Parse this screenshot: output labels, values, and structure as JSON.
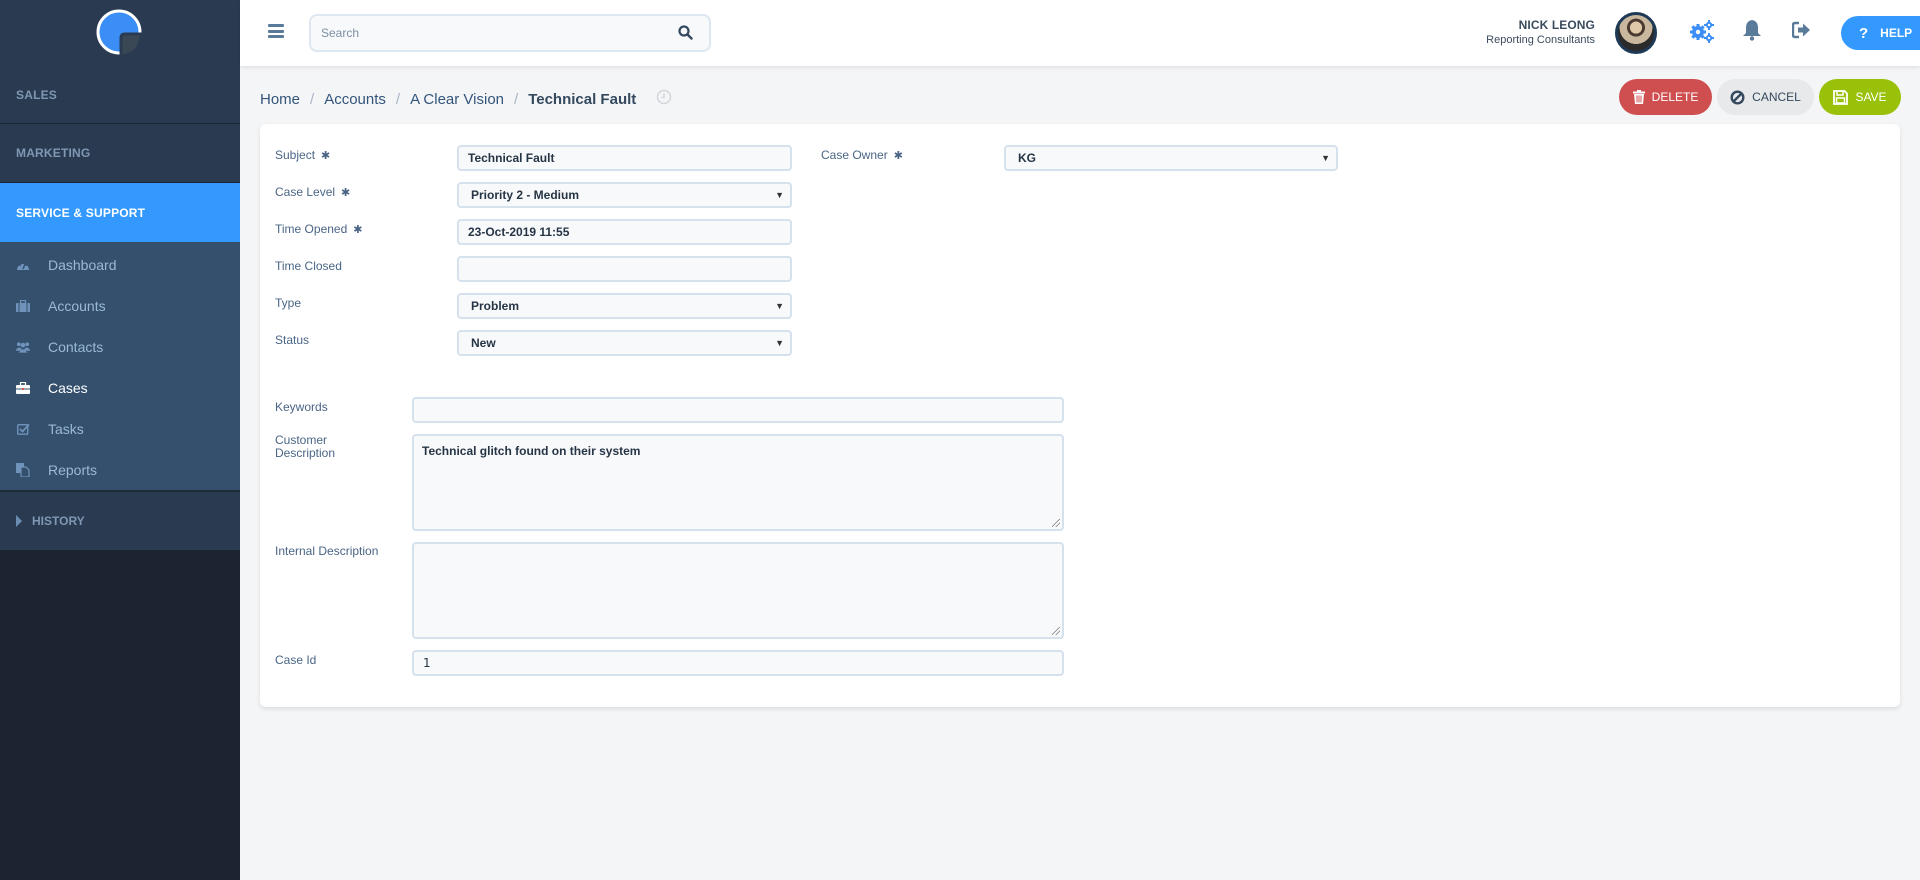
{
  "sidebar": {
    "sections": [
      {
        "label": "SALES"
      },
      {
        "label": "MARKETING"
      },
      {
        "label": "SERVICE & SUPPORT",
        "active": true
      }
    ],
    "items": [
      {
        "label": "Dashboard",
        "icon": "dashboard-icon"
      },
      {
        "label": "Accounts",
        "icon": "briefcase-icon"
      },
      {
        "label": "Contacts",
        "icon": "users-icon"
      },
      {
        "label": "Cases",
        "icon": "toolbox-icon",
        "active": true
      },
      {
        "label": "Tasks",
        "icon": "checkbox-icon"
      },
      {
        "label": "Reports",
        "icon": "copy-icon"
      }
    ],
    "history_label": "HISTORY"
  },
  "header": {
    "search_placeholder": "Search",
    "user_name": "NICK LEONG",
    "user_org": "Reporting Consultants",
    "help_label": "HELP"
  },
  "breadcrumb": {
    "items": [
      "Home",
      "Accounts",
      "A Clear Vision"
    ],
    "current": "Technical Fault"
  },
  "actions": {
    "delete_label": "DELETE",
    "cancel_label": "CANCEL",
    "save_label": "SAVE"
  },
  "form": {
    "subject": {
      "label": "Subject",
      "value": "Technical Fault",
      "required": true
    },
    "case_level": {
      "label": "Case Level",
      "value": "Priority 2 - Medium",
      "required": true
    },
    "time_opened": {
      "label": "Time Opened",
      "value": "23-Oct-2019 11:55",
      "required": true
    },
    "time_closed": {
      "label": "Time Closed",
      "value": ""
    },
    "type": {
      "label": "Type",
      "value": "Problem"
    },
    "status": {
      "label": "Status",
      "value": "New"
    },
    "case_owner": {
      "label": "Case Owner",
      "value": "KG",
      "required": true
    },
    "keywords": {
      "label": "Keywords",
      "value": ""
    },
    "customer_description": {
      "label_line1": "Customer",
      "label_line2": "Description",
      "value": "Technical glitch found on their system"
    },
    "internal_description": {
      "label": "Internal Description",
      "value": ""
    },
    "case_id": {
      "label": "Case Id",
      "value": "1"
    },
    "required_marker": "✱",
    "caret": "▼"
  },
  "colors": {
    "accent": "#3399ff",
    "sidebar_bg": "#2a3b51",
    "delete": "#cf4f50",
    "save": "#99c10a"
  }
}
